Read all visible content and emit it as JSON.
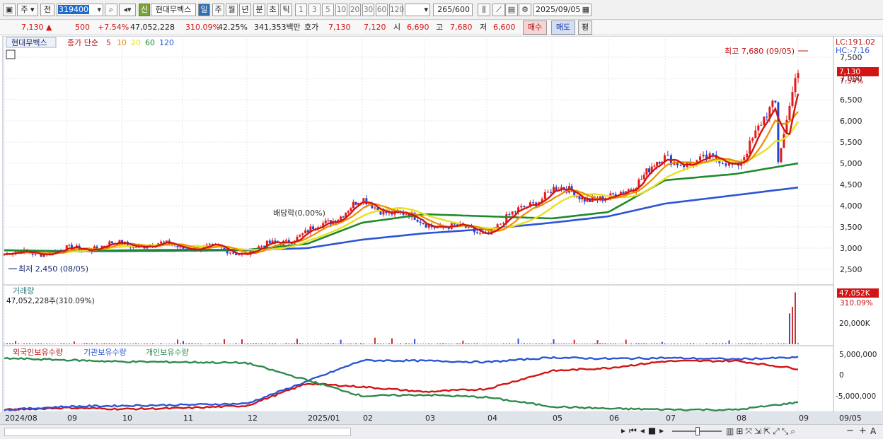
{
  "toolbar": {
    "market_label": "주",
    "price_type": "전",
    "stock_code": "319400",
    "stock_name": "현대무벡스",
    "new_badge": "신",
    "periods": [
      "일",
      "주",
      "월",
      "년",
      "분",
      "초",
      "틱"
    ],
    "selected_period": "일",
    "intervals": [
      "1",
      "3",
      "5",
      "10",
      "20",
      "30",
      "60",
      "120"
    ],
    "count_value": "265",
    "count_total": "/600",
    "date": "2025/09/05"
  },
  "quote": {
    "price": "7,130",
    "change": "500",
    "change_pct": "+7.54%",
    "volume": "47,052,228",
    "volume_ratio": "310.09%",
    "turnover": "42.25%",
    "amount": "341,353백만",
    "ask_label": "호가",
    "ask": "7,130",
    "bid": "7,120",
    "open_label": "시",
    "open": "6,690",
    "high_label": "고",
    "high": "7,680",
    "low_label": "저",
    "low": "6,600",
    "buy_label": "매수",
    "sell_label": "매도",
    "eval_label": "평"
  },
  "legend": {
    "stock_name": "현대무벡스",
    "close_label": "종가 단순",
    "ma_periods": [
      "5",
      "10",
      "20",
      "60",
      "120"
    ],
    "ma_colors": [
      "#d21414",
      "#f08c00",
      "#e8e020",
      "#1f8a2a",
      "#2b55d6"
    ]
  },
  "annotations": {
    "high": "최고 7,680 (09/05)",
    "low": "최저 2,450 (08/05)",
    "dividend": "배당락(0,00%)"
  },
  "price_axis": {
    "ticks": [
      "7,500",
      "7,000",
      "6,500",
      "6,000",
      "5,500",
      "5,000",
      "4,500",
      "4,000",
      "3,500",
      "3,000",
      "2,500"
    ],
    "lc": "LC:191.02",
    "hc": "HC:-7.16",
    "current": "7,130",
    "current_pct": "7.54%"
  },
  "volume_panel": {
    "title": "거래량",
    "value": "47,052,228주(310.09%)",
    "axis_current": "47,052K",
    "axis_pct": "310.09%",
    "axis_tick": "20,000K"
  },
  "holding_panel": {
    "series": [
      "외국인보유수량",
      "기관보유수량",
      "개인보유수량"
    ],
    "colors": [
      "#d21414",
      "#2b55d6",
      "#2e8a4e"
    ],
    "ticks": [
      "5,000,000",
      "0",
      "-5,000,000"
    ]
  },
  "x_axis": {
    "labels": [
      "2024/08",
      "09",
      "10",
      "11",
      "12",
      "2025/01",
      "02",
      "03",
      "04",
      "05",
      "06",
      "07",
      "08",
      "09"
    ],
    "right_label": "09/05"
  },
  "chart_data": {
    "type": "line",
    "title": "현대무벡스",
    "x": [
      "2024/08",
      "2024/09",
      "2024/10",
      "2024/11",
      "2024/12",
      "2025/01",
      "2025/02",
      "2025/03",
      "2025/04",
      "2025/05",
      "2025/06",
      "2025/07",
      "2025/08",
      "2025/09"
    ],
    "series": [
      {
        "name": "종가",
        "values": [
          2850,
          2950,
          3100,
          3050,
          2900,
          3350,
          4100,
          3600,
          3350,
          4400,
          4100,
          5100,
          5000,
          7130
        ]
      },
      {
        "name": "5",
        "values": [
          2850,
          2950,
          3100,
          3050,
          2900,
          3350,
          4100,
          3600,
          3350,
          4350,
          4100,
          5000,
          5000,
          6200
        ]
      },
      {
        "name": "60",
        "values": [
          2950,
          2920,
          2950,
          2960,
          2960,
          3100,
          3600,
          3800,
          3750,
          3700,
          3850,
          4600,
          4750,
          5000
        ]
      },
      {
        "name": "120",
        "values": [
          2950,
          2930,
          2930,
          2940,
          2950,
          3000,
          3200,
          3350,
          3450,
          3600,
          3750,
          4050,
          4250,
          4430
        ]
      }
    ],
    "ylim": [
      2300,
      7800
    ],
    "volume_ylim_k": [
      0,
      50000
    ],
    "holding_ylim": [
      -8000000,
      6500000
    ]
  }
}
